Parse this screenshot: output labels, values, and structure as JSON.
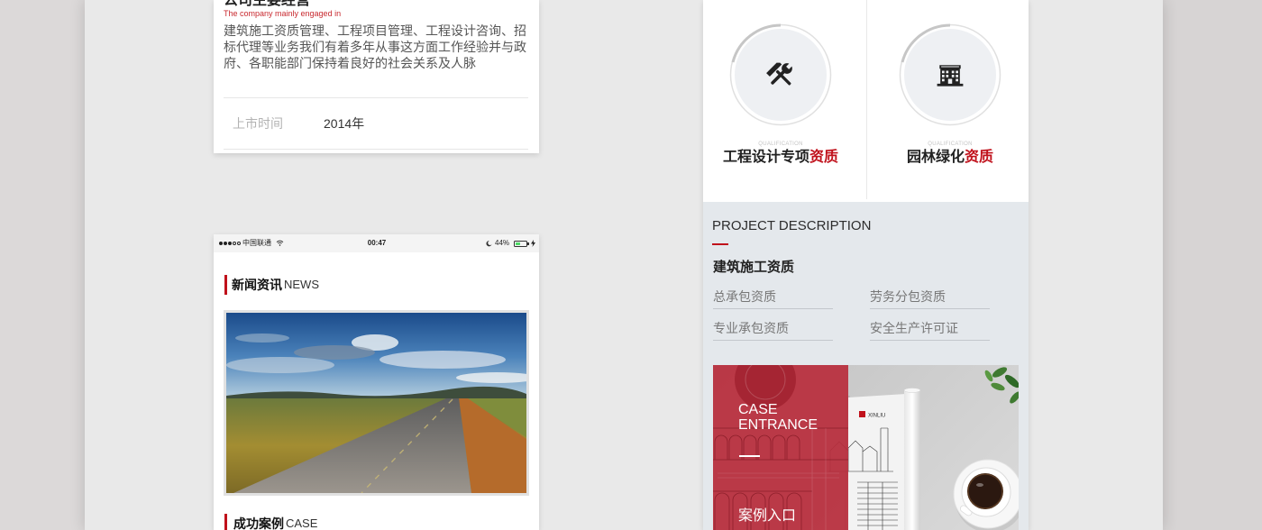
{
  "colors": {
    "accent_red": "#c0111b",
    "page_bg": "#e9e9e9",
    "panel_bg": "#e4e8ec"
  },
  "company_card": {
    "heading": "公司主要经营",
    "subheading": "The company mainly engaged in",
    "body": "建筑施工资质管理、工程项目管理、工程设计咨询、招标代理等业务我们有着多年从事这方面工作经验并与政府、各职能部门保持着良好的社会关系及人脉",
    "info": {
      "label": "上市时间",
      "value": "2014年"
    }
  },
  "phone_screen": {
    "status_bar": {
      "signal_level": 3,
      "carrier": "中国联通",
      "time": "00:47",
      "battery": "44%"
    },
    "news_section": {
      "title_cn": "新闻资讯",
      "title_en": "NEWS"
    },
    "case_section": {
      "title_cn": "成功案例",
      "title_en": "CASE"
    }
  },
  "qualifications": [
    {
      "tag": "QUALIFICATION",
      "name": "工程设计专项",
      "highlight": "资质",
      "icon": "tools-icon"
    },
    {
      "tag": "QUALIFICATION",
      "name": "园林绿化",
      "highlight": "资质",
      "icon": "building-icon"
    }
  ],
  "project_description": {
    "title": "PROJECT DESCRIPTION",
    "subtitle": "建筑施工资质",
    "items": [
      "总承包资质",
      "劳务分包资质",
      "专业承包资质",
      "安全生产许可证"
    ]
  },
  "case_entrance": {
    "title_en_line1": "CASE",
    "title_en_line2": "ENTRANCE",
    "title_cn": "案例入口",
    "brand": "XINLIU"
  }
}
